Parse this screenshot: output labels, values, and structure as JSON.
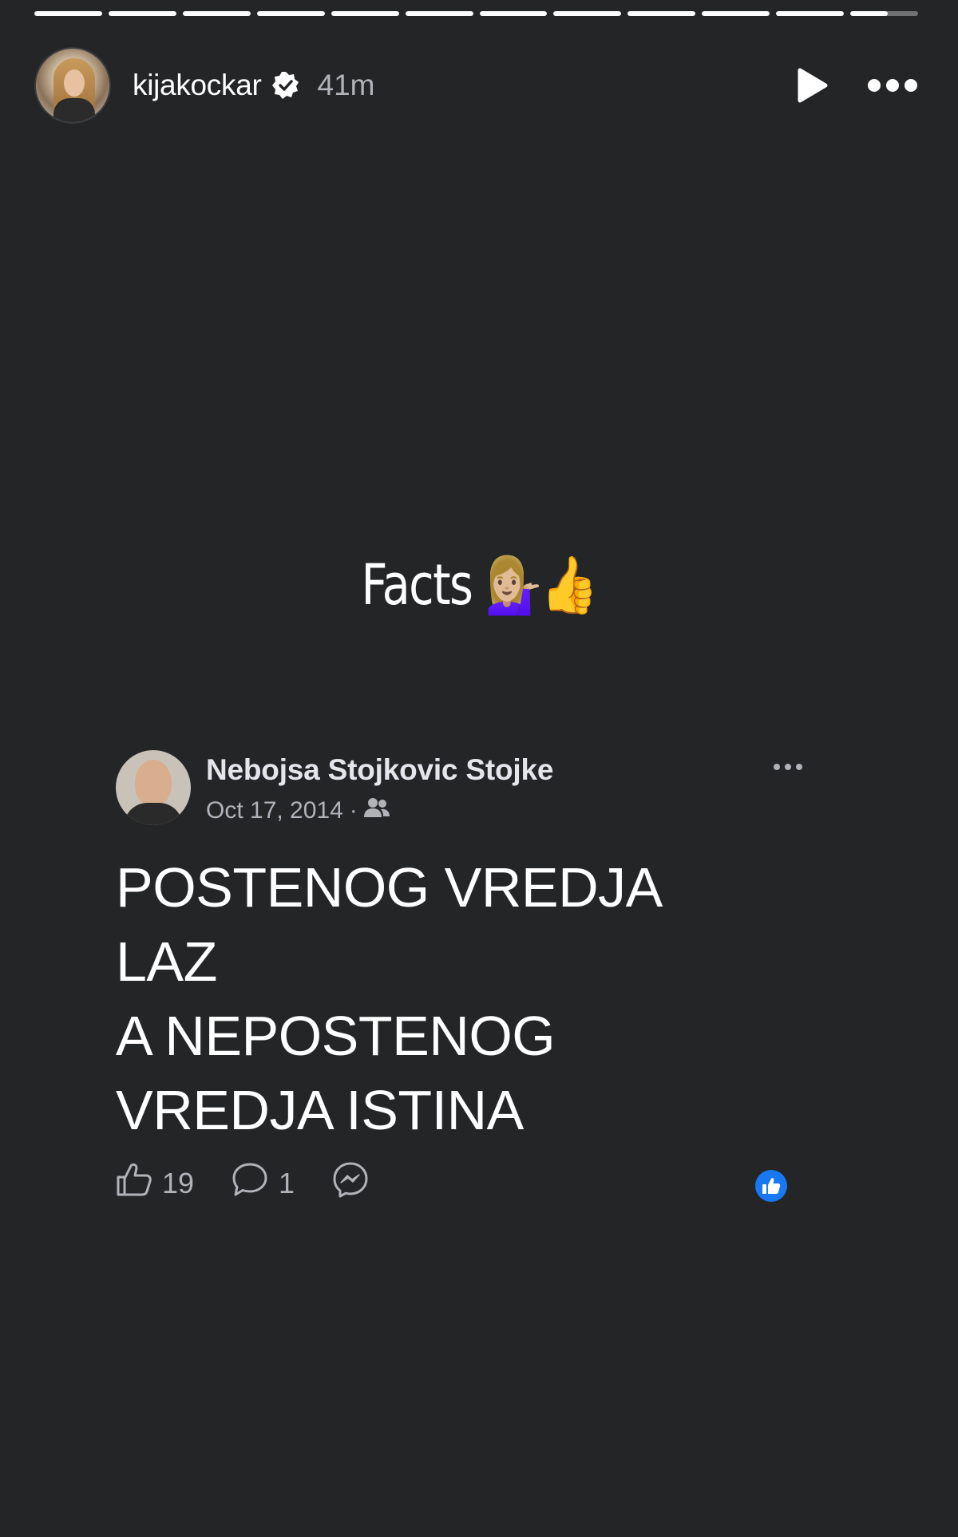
{
  "story": {
    "progress": {
      "segments_total": 12,
      "segments_complete": 11,
      "current_segment_fraction": 0.55
    },
    "header": {
      "username": "kijakockar",
      "verified": true,
      "time_ago": "41m",
      "avatar_icon": "profile-photo",
      "play_icon": "play-icon",
      "more_icon": "more-horizontal-icon"
    },
    "caption": "Facts 💁🏼‍♀️👍"
  },
  "shared_post": {
    "author": "Nebojsa Stojkovic Stojke",
    "date": "Oct 17, 2014",
    "separator": "·",
    "audience_icon": "friends-icon",
    "text_lines": [
      "POSTENOG VREDJA",
      "LAZ",
      "A NEPOSTENOG",
      "VREDJA ISTINA"
    ],
    "likes": "19",
    "comments": "1",
    "like_icon": "thumbs-up-outline-icon",
    "comment_icon": "comment-icon",
    "share_icon": "messenger-icon",
    "reaction_icon": "like-reaction-icon"
  },
  "colors": {
    "background": "#242527",
    "text": "#ffffff",
    "secondary_text": "#b0b3b8",
    "like_blue": "#1877f2"
  }
}
